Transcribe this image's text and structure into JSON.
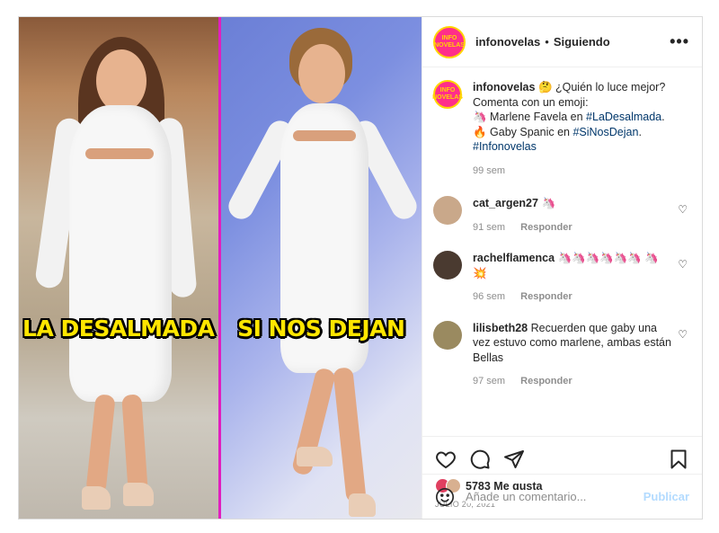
{
  "post": {
    "image": {
      "left_label": "LA DESALMADA",
      "right_label": "SI NOS DEJAN"
    },
    "header": {
      "username": "infonovelas",
      "separator": "•",
      "follow_status": "Siguiendo",
      "more_label": "•••",
      "avatar_text": "INFO NOVELAS"
    },
    "caption": {
      "username": "infonovelas",
      "line1": "🤔 ¿Quién lo luce mejor? Comenta con un emoji:",
      "line2_prefix": "🦄 Marlene Favela en ",
      "line2_tag": "#LaDesalmada",
      "line2_suffix": ".",
      "line3_prefix": "🔥 Gaby Spanic en ",
      "line3_tag": "#SiNosDejan",
      "line3_suffix": ".",
      "line4_tag": "#Infonovelas",
      "time": "99 sem"
    },
    "comments": [
      {
        "username": "cat_argen27",
        "text": "🦄",
        "time": "91 sem",
        "reply": "Responder",
        "avatar_color": "#c9a88a"
      },
      {
        "username": "rachelflamenca",
        "text": "🦄🦄🦄🦄🦄🦄 🦄💥",
        "time": "96 sem",
        "reply": "Responder",
        "avatar_color": "#4a3a30"
      },
      {
        "username": "lilisbeth28",
        "text": "Recuerden que gaby una vez estuvo como marlene, ambas están Bellas",
        "time": "97 sem",
        "reply": "Responder",
        "avatar_color": "#9a8a60"
      }
    ],
    "likes": {
      "count_text": "5783 Me gusta",
      "date": "JULIO 20, 2021"
    },
    "add_comment": {
      "placeholder": "Añade un comentario...",
      "post_label": "Publicar"
    },
    "icons": {
      "like": "heart-icon",
      "comment": "comment-icon",
      "share": "share-icon",
      "save": "bookmark-icon",
      "emoji": "emoji-icon"
    },
    "colors": {
      "divider": "#e01fbf",
      "overlay_text": "#ffe600",
      "hashtag": "#00376b",
      "publish_disabled": "#b3dbff"
    }
  }
}
